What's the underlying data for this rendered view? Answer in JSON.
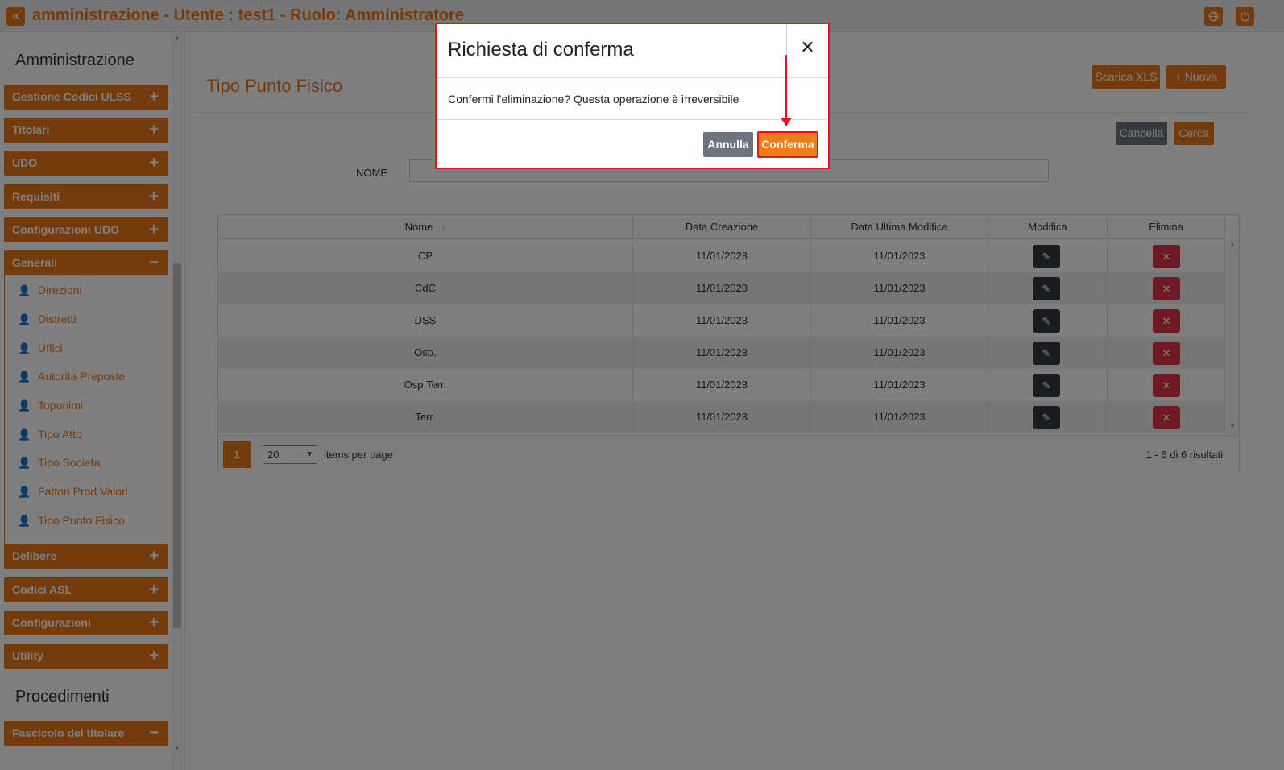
{
  "topbar": {
    "back_icon": "chevrons-left-icon",
    "title": "amministrazione - Utente : test1 - Ruolo: Amministratore",
    "globe_icon": "globe-icon",
    "power_icon": "power-icon"
  },
  "sidebar": {
    "section1": "Amministrazione",
    "groups": [
      {
        "label": "Gestione Codici ULSS",
        "sign": "+"
      },
      {
        "label": "Titolari",
        "sign": "+"
      },
      {
        "label": "UDO",
        "sign": "+"
      },
      {
        "label": "Requisiti",
        "sign": "+"
      },
      {
        "label": "Configurazioni UDO",
        "sign": "+"
      },
      {
        "label": "Generali",
        "sign": "−"
      },
      {
        "label": "Delibere",
        "sign": "+"
      },
      {
        "label": "Codici ASL",
        "sign": "+"
      },
      {
        "label": "Configurazioni",
        "sign": "+"
      },
      {
        "label": "Utility",
        "sign": "+"
      }
    ],
    "generali_items": [
      "Direzioni",
      "Distretti",
      "Uffici",
      "Autorita Preposte",
      "Toponimi",
      "Tipo Atto",
      "Tipo Societa",
      "Fattori Prod Valori",
      "Tipo Punto Fisico"
    ],
    "section2": "Procedimenti",
    "proc_group": {
      "label": "Fascicolo del titolare",
      "sign": "−"
    }
  },
  "main": {
    "page_title": "Tipo Punto Fisico",
    "scarica_label": "Scarica XLS",
    "nuova_label": "+ Nuova",
    "cancella_label": "Cancella",
    "cerca_label": "Cerca",
    "filter_label": "NOME",
    "filter_value": "",
    "columns": [
      "Nome",
      "Data Creazione",
      "Data Ultima Modifica",
      "Modifica",
      "Elimina"
    ],
    "sort_indicator": "↑",
    "rows": [
      {
        "nome": "CP",
        "creazione": "11/01/2023",
        "modifica": "11/01/2023"
      },
      {
        "nome": "CdC",
        "creazione": "11/01/2023",
        "modifica": "11/01/2023"
      },
      {
        "nome": "DSS",
        "creazione": "11/01/2023",
        "modifica": "11/01/2023"
      },
      {
        "nome": "Osp.",
        "creazione": "11/01/2023",
        "modifica": "11/01/2023"
      },
      {
        "nome": "Osp.Terr.",
        "creazione": "11/01/2023",
        "modifica": "11/01/2023"
      },
      {
        "nome": "Terr.",
        "creazione": "11/01/2023",
        "modifica": "11/01/2023"
      }
    ],
    "pager": {
      "current_page": "1",
      "page_size": "20",
      "items_per_page": "items per page",
      "results": "1 - 6 di 6 risultati"
    }
  },
  "modal": {
    "title": "Richiesta di conferma",
    "close": "✕",
    "message": "Confermi l'eliminazione? Questa operazione è irreversibile",
    "annulla": "Annulla",
    "conferma": "Conferma"
  },
  "colors": {
    "accent": "#e8761a",
    "danger": "#dc3545",
    "dark": "#343a40",
    "annotation": "#e0161e"
  }
}
